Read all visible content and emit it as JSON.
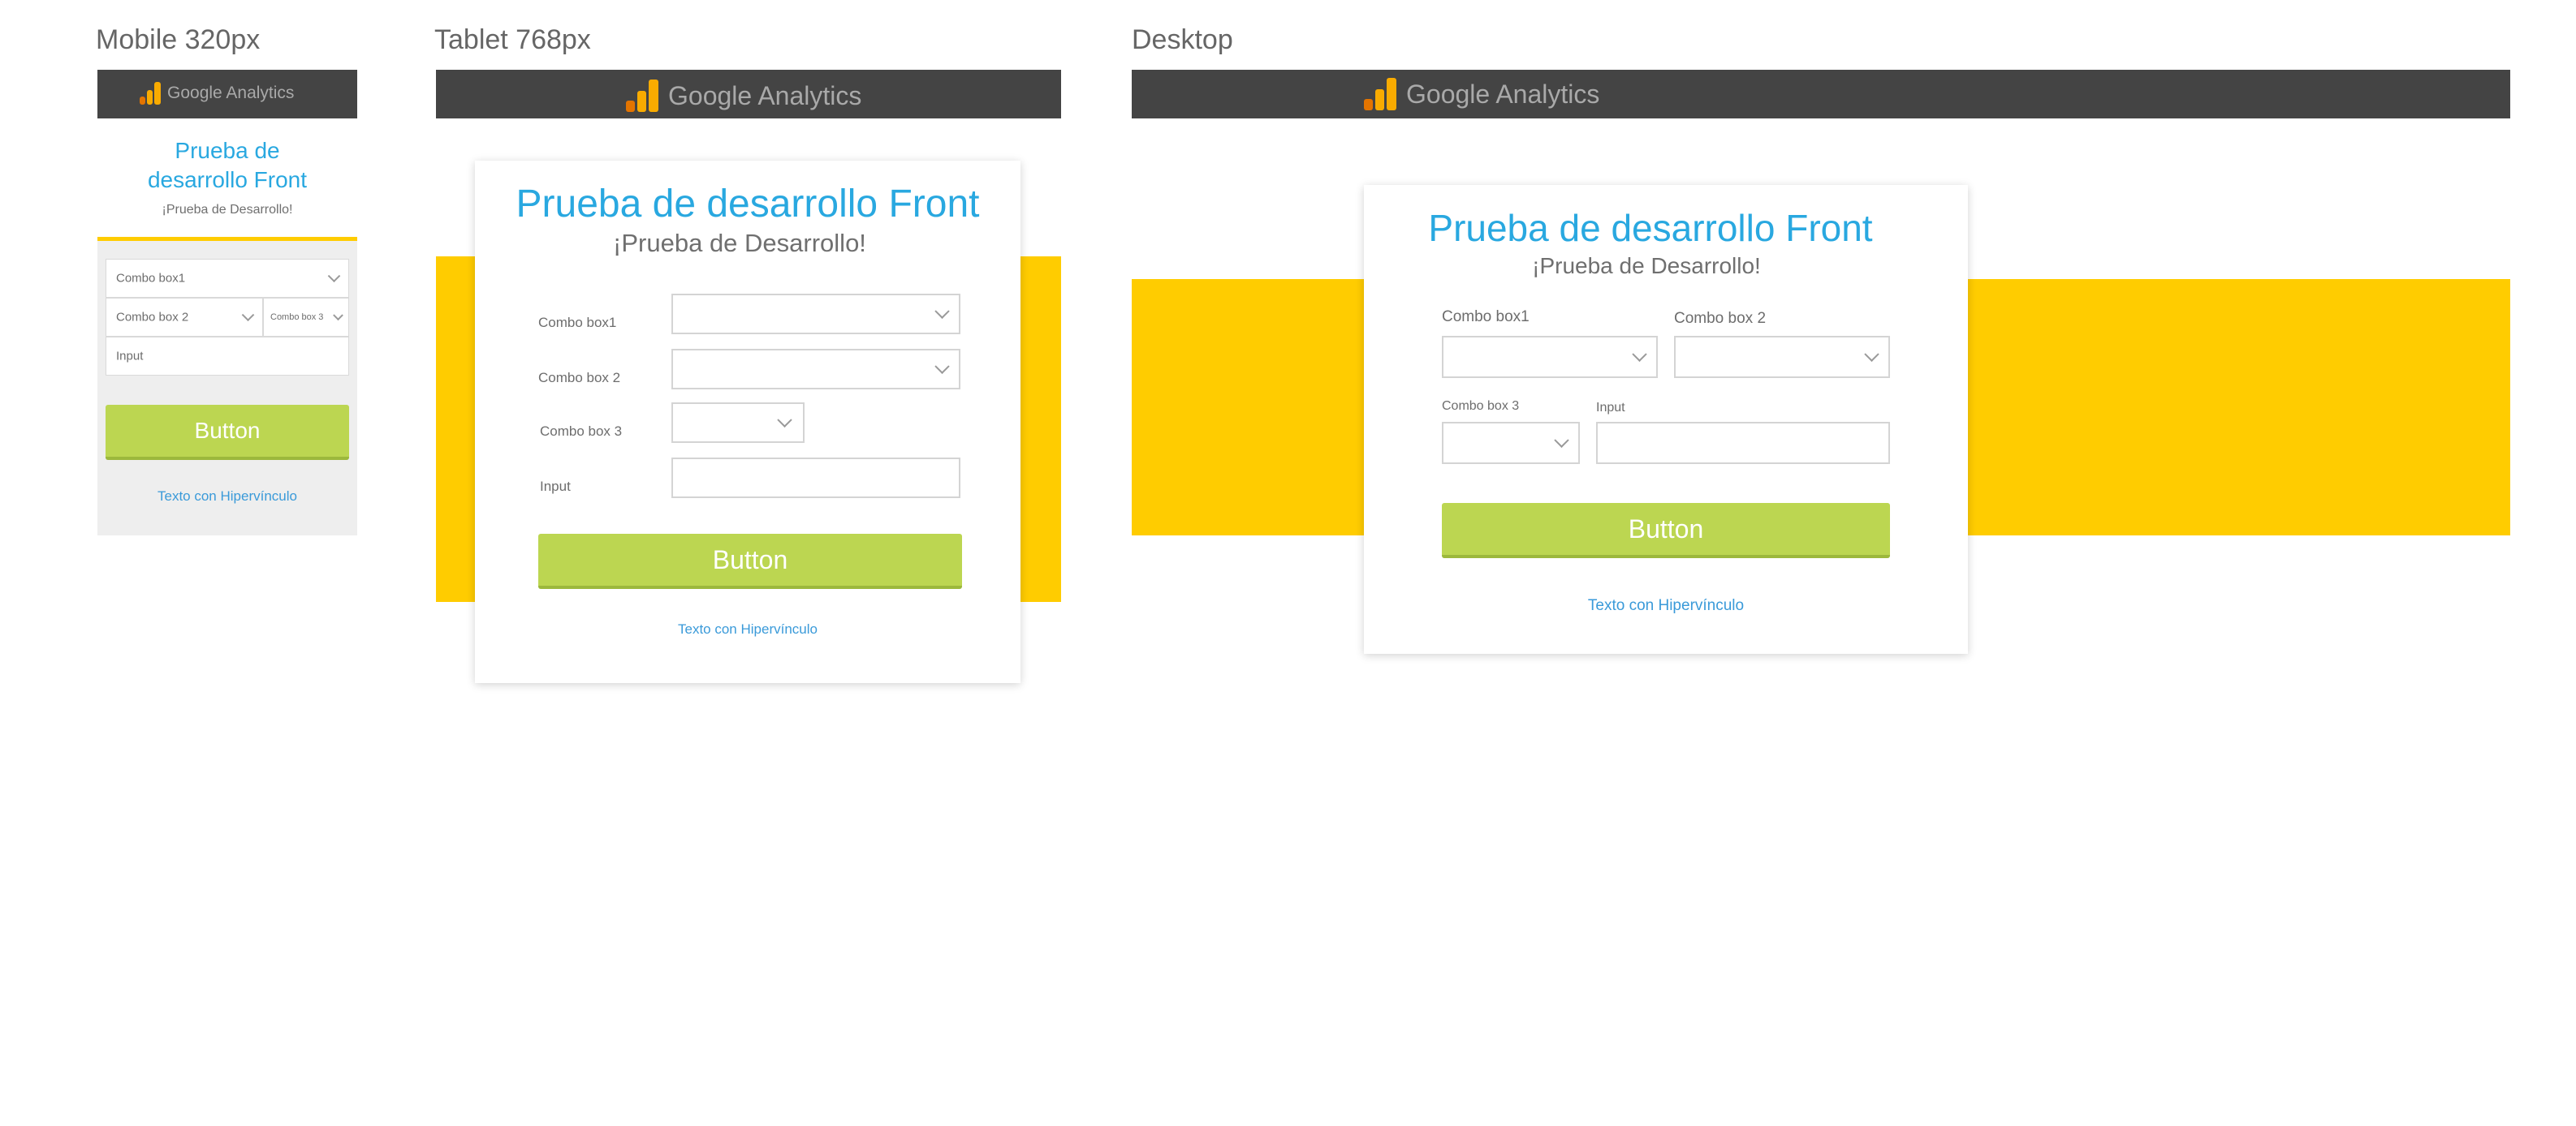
{
  "brand": {
    "name": "Google Analytics",
    "bar_color": "#444444",
    "logo_colors": [
      "#f9ab00",
      "#e37400"
    ]
  },
  "colors": {
    "accent_yellow": "#ffcc00",
    "title_blue": "#29a8e0",
    "button_green": "#bcd651",
    "link_blue": "#3a9ad9"
  },
  "mobile": {
    "label": "Mobile 320px",
    "title_line1": "Prueba de",
    "title_line2": "desarrollo Front",
    "subtitle": "¡Prueba de Desarrollo!",
    "combo1": "Combo box1",
    "combo2": "Combo box 2",
    "combo3": "Combo box 3",
    "input": "Input",
    "button": "Button",
    "link": "Texto con Hipervínculo"
  },
  "tablet": {
    "label": "Tablet 768px",
    "title": "Prueba de desarrollo Front",
    "subtitle": "¡Prueba de Desarrollo!",
    "combo1": "Combo box1",
    "combo2": "Combo box 2",
    "combo3": "Combo box 3",
    "input": "Input",
    "button": "Button",
    "link": "Texto con Hipervínculo"
  },
  "desktop": {
    "label": "Desktop",
    "title": "Prueba de desarrollo Front",
    "subtitle": "¡Prueba de Desarrollo!",
    "combo1": "Combo box1",
    "combo2": "Combo box 2",
    "combo3": "Combo box 3",
    "input": "Input",
    "button": "Button",
    "link": "Texto con Hipervínculo"
  }
}
